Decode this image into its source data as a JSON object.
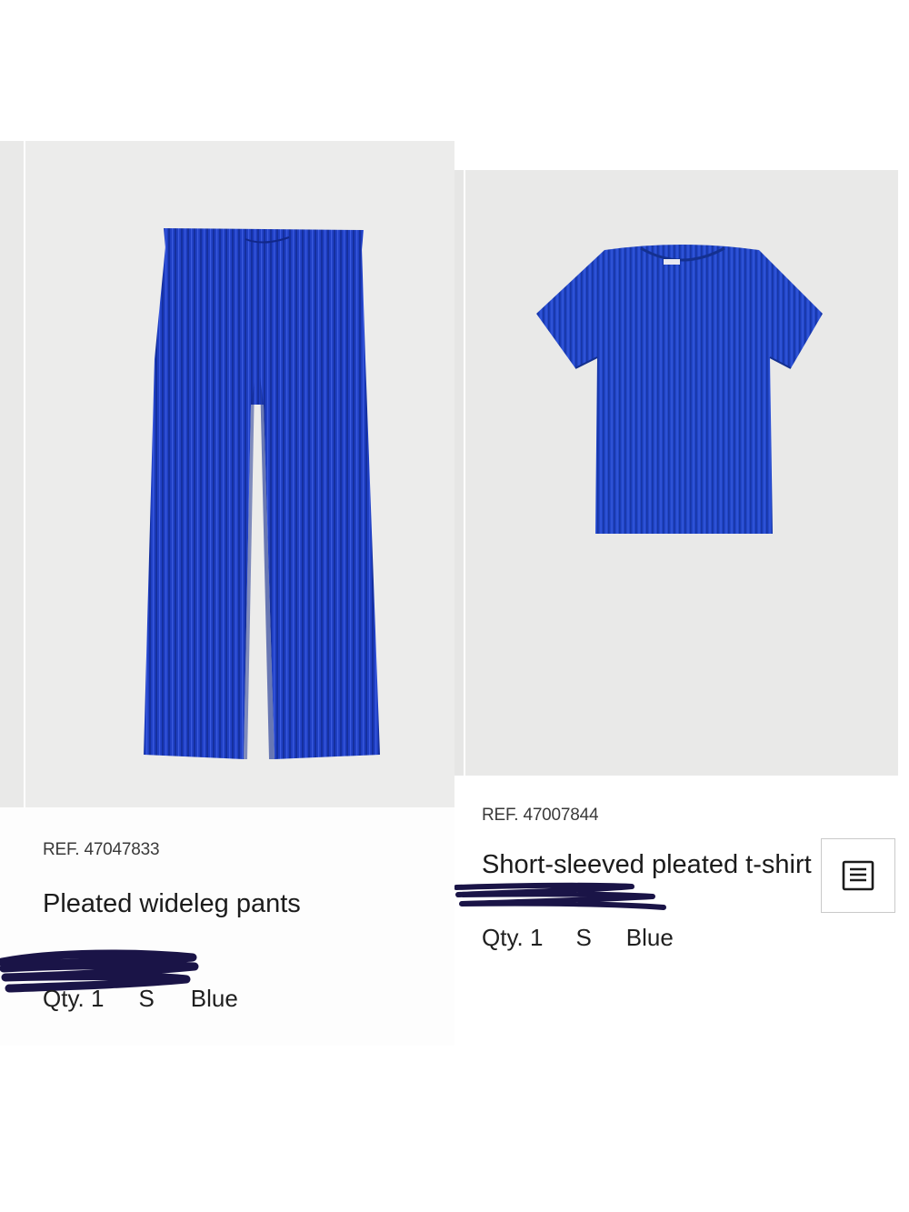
{
  "products": [
    {
      "ref": "REF. 47047833",
      "name": "Pleated wideleg pants",
      "qty": "Qty. 1",
      "size": "S",
      "color_name": "Blue"
    },
    {
      "ref": "REF. 47007844",
      "name": "Short-sleeved pleated t-shirt",
      "qty": "Qty. 1",
      "size": "S",
      "color_name": "Blue"
    }
  ],
  "icons": {
    "memo": "note-list-icon"
  },
  "colors": {
    "garment_blue": "#1f3fc3",
    "redaction_ink": "#1a1447",
    "photo_background": "#ececeb"
  }
}
